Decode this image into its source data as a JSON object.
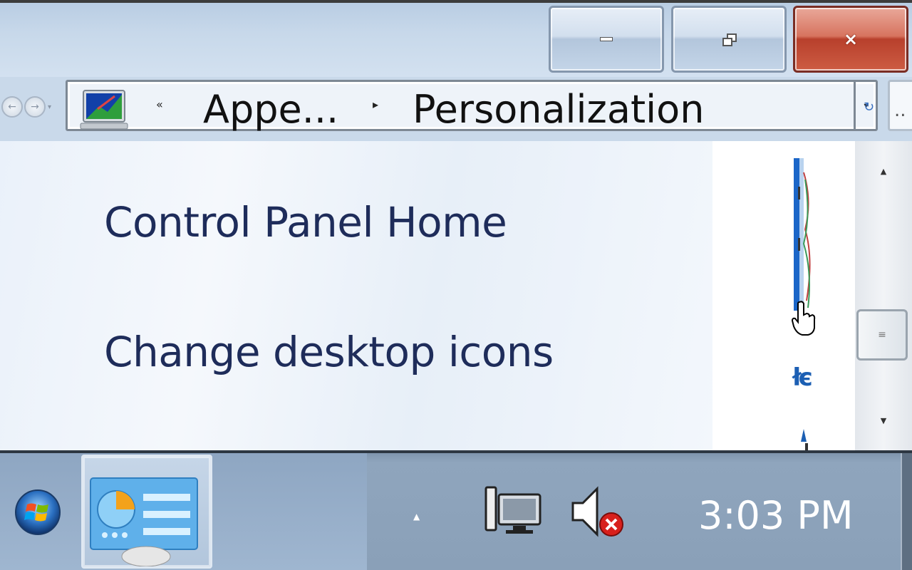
{
  "window": {
    "buttons": {
      "minimize_icon": "minimize-icon",
      "maximize_icon": "restore-icon",
      "close_icon": "close-icon",
      "close_glyph": "×"
    }
  },
  "address_bar": {
    "icon": "control-panel-icon",
    "overflow_chevron": "«",
    "breadcrumbs": [
      {
        "label": "Appe..."
      },
      {
        "label": "Personalization"
      }
    ],
    "separator": "▸",
    "dropdown_glyph": "▾",
    "refresh_glyph": "↻",
    "search_text": ".."
  },
  "nav": {
    "back_glyph": "←",
    "forward_glyph": "→",
    "history_glyph": "▾"
  },
  "left_pane": {
    "links": [
      {
        "label": "Control Panel Home"
      },
      {
        "label": "Change desktop icons"
      }
    ]
  },
  "content_pane": {
    "theme_fragment": "łє"
  },
  "scrollbar": {
    "up_glyph": "▲",
    "down_glyph": "▼",
    "thumb_grip": "≡"
  },
  "taskbar": {
    "start_icon": "windows-start-orb-icon",
    "pinned_app_icon": "control-panel-icon",
    "tray_show_hidden_glyph": "▲",
    "network_icon": "network-icon",
    "volume_icon": "volume-muted-icon",
    "clock": "3:03 PM"
  },
  "colors": {
    "link": "#1e2c5a",
    "close_button": "#c0432e",
    "taskbar": "#8aa0b8"
  }
}
